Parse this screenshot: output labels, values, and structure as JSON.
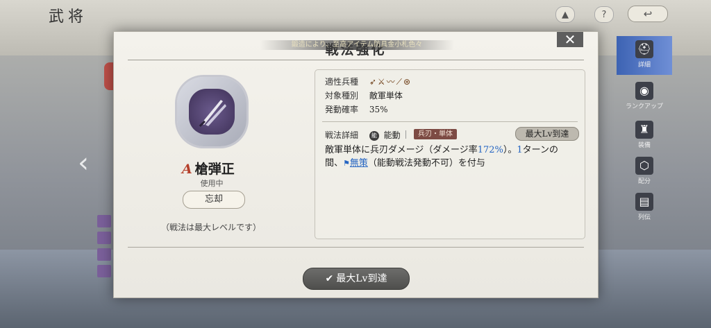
{
  "background": {
    "title": "武将",
    "help_icon_text": "?",
    "right_rail": [
      {
        "label": "詳細"
      },
      {
        "label": "ランクアップ"
      },
      {
        "label": "装備"
      },
      {
        "label": "配分"
      },
      {
        "label": "列伝"
      }
    ]
  },
  "panel": {
    "ticker": "鍛造により、至高アイテム防具金小札色々",
    "title": "戦法強化",
    "close_label": "✕",
    "skill": {
      "rank": "A",
      "name": "槍弾正",
      "status": "使用中",
      "forget_label": "忘却",
      "max_note": "（戦法は最大レベルです）"
    },
    "info": {
      "unit_label": "適性兵種",
      "unit_icons": "➶⚔〰⟋⊛",
      "target_label": "対象種別",
      "target_value": "敵軍単体",
      "chance_label": "発動確率",
      "chance_value": "35%",
      "detail_label": "戦法詳細",
      "active_chip": "能",
      "type_value": "能動",
      "tag": "兵刃・単体",
      "max_lv_badge": "最大Lv到達",
      "desc_1": "敵軍単体に兵刃ダメージ（ダメージ率",
      "desc_rate": "172%",
      "desc_2": "）。",
      "desc_turns": "1",
      "desc_3": "ターンの間、",
      "desc_status": "無策",
      "desc_4": "（能動戦法発動不可）を付与"
    },
    "bottom_button": "最大Lv到達"
  },
  "colors": {
    "highlight": "#2565c2",
    "rank": "#b5402b",
    "tag_bg": "#7d4b44"
  }
}
